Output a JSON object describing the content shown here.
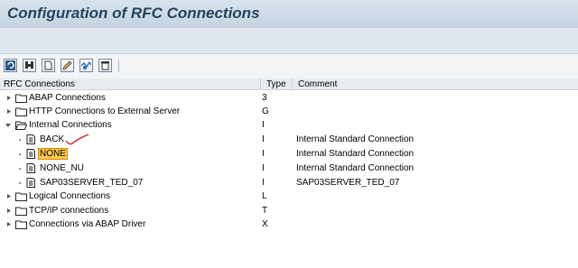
{
  "window": {
    "title": "Configuration of RFC Connections"
  },
  "toolbar": {
    "buttons": [
      "refresh-icon",
      "find-icon",
      "create-icon",
      "change-icon",
      "test-icon",
      "delete-icon"
    ]
  },
  "columns": {
    "name": "RFC Connections",
    "type": "Type",
    "comment": "Comment"
  },
  "rows": [
    {
      "label": "ABAP Connections",
      "type": "3",
      "comment": ""
    },
    {
      "label": "HTTP Connections to External Server",
      "type": "G",
      "comment": ""
    },
    {
      "label": "Internal Connections",
      "type": "I",
      "comment": ""
    },
    {
      "label": "BACK",
      "type": "I",
      "comment": "Internal Standard Connection"
    },
    {
      "label": "NONE",
      "type": "I",
      "comment": "Internal Standard Connection"
    },
    {
      "label": "NONE_NU",
      "type": "I",
      "comment": "Internal Standard Connection"
    },
    {
      "label": "SAP03SERVER_TED_07",
      "type": "I",
      "comment": "SAP03SERVER_TED_07"
    },
    {
      "label": "Logical Connections",
      "type": "L",
      "comment": ""
    },
    {
      "label": "TCP/IP connections",
      "type": "T",
      "comment": ""
    },
    {
      "label": "Connections via ABAP Driver",
      "type": "X",
      "comment": ""
    }
  ]
}
